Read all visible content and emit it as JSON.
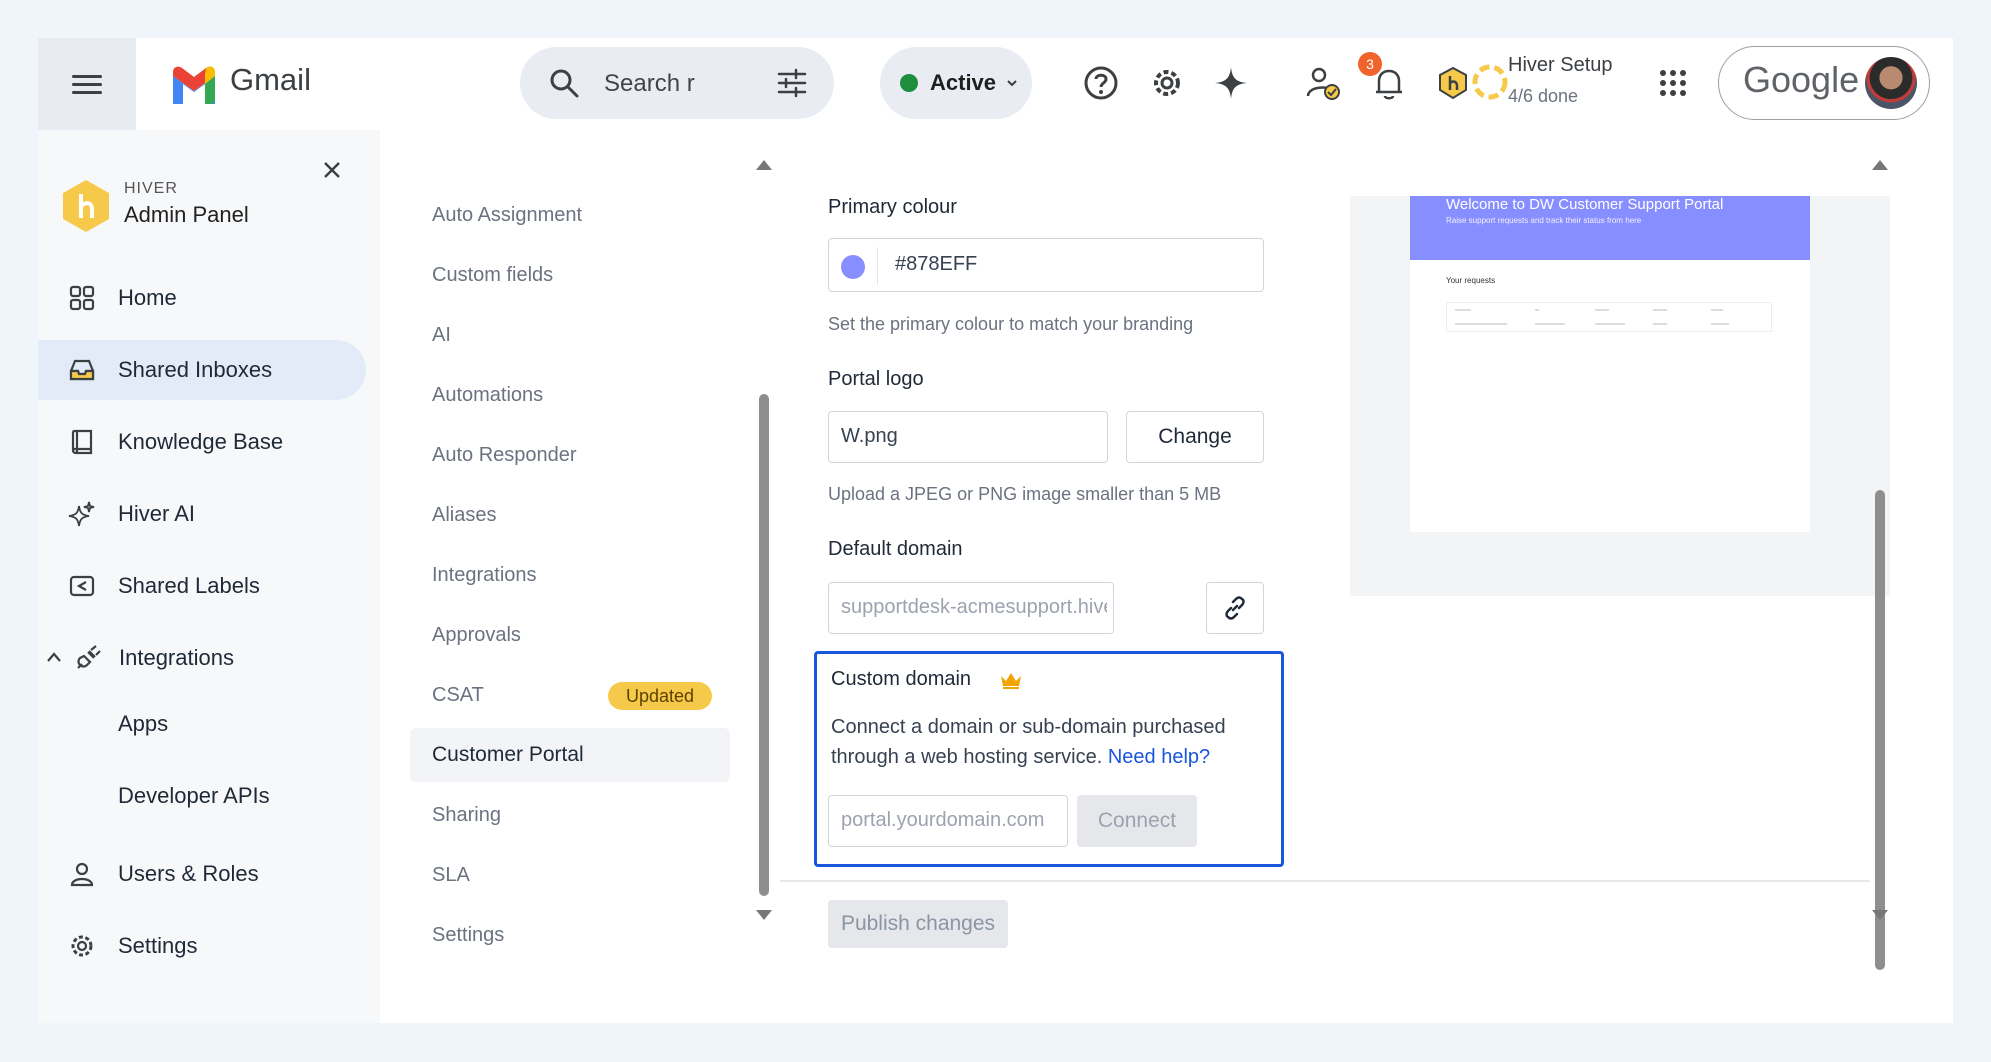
{
  "app": {
    "gmail_label": "Gmail",
    "search_placeholder": "Search r",
    "status": "Active",
    "notifications_count": "3",
    "setup_title": "Hiver Setup",
    "setup_progress": "4/6 done",
    "google_label": "Google"
  },
  "sidebar": {
    "brand_small": "HIVER",
    "brand_title": "Admin Panel",
    "items": [
      {
        "label": "Home",
        "icon": "grid-icon"
      },
      {
        "label": "Shared Inboxes",
        "icon": "inbox-icon",
        "active": true
      },
      {
        "label": "Knowledge Base",
        "icon": "book-icon"
      },
      {
        "label": "Hiver AI",
        "icon": "sparkle-icon"
      },
      {
        "label": "Shared Labels",
        "icon": "label-icon"
      },
      {
        "label": "Integrations",
        "icon": "plug-icon",
        "expanded": true
      },
      {
        "label": "Apps"
      },
      {
        "label": "Developer APIs"
      },
      {
        "label": "Users & Roles",
        "icon": "user-icon"
      },
      {
        "label": "Settings",
        "icon": "gear-icon"
      }
    ]
  },
  "submenu": {
    "items": [
      "Auto Assignment",
      "Custom fields",
      "AI",
      "Automations",
      "Auto Responder",
      "Aliases",
      "Integrations",
      "Approvals",
      "CSAT",
      "Customer Portal",
      "Sharing",
      "SLA",
      "Settings"
    ],
    "active": "Customer Portal",
    "csat_badge": "Updated"
  },
  "form": {
    "primary_colour_label": "Primary colour",
    "primary_colour_value": "#878EFF",
    "primary_colour_help": "Set the primary colour to match your branding",
    "portal_logo_label": "Portal logo",
    "portal_logo_value": "W.png",
    "change_button": "Change",
    "portal_logo_help": "Upload a JPEG or PNG image smaller than 5 MB",
    "default_domain_label": "Default domain",
    "default_domain_value": "supportdesk-acmesupport.hiver-portal.com",
    "custom_domain_label": "Custom domain",
    "custom_domain_desc": "Connect a domain or sub-domain purchased through a web hosting service.",
    "need_help_link": "Need help?",
    "custom_domain_placeholder": "portal.yourdomain.com",
    "connect_button": "Connect",
    "publish_button": "Publish changes"
  },
  "preview": {
    "title": "Welcome to DW Customer Support Portal",
    "subtitle": "Raise support requests and track their status from here",
    "requests_label": "Your requests"
  },
  "colors": {
    "accent": "#1a56db",
    "portal_primary": "#878EFF",
    "badge": "#f6c94a"
  }
}
